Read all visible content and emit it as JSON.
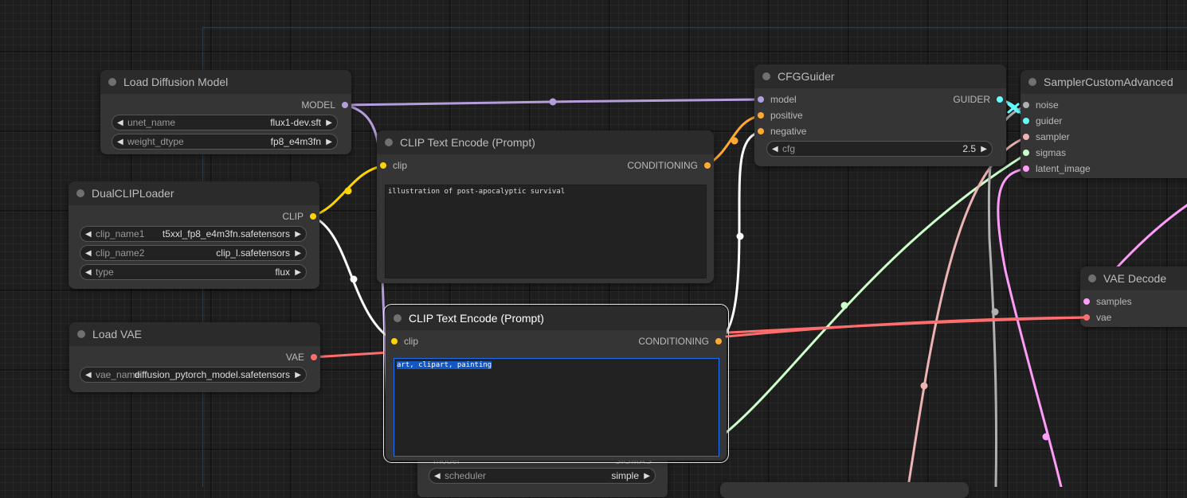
{
  "colors": {
    "model": "#b39ddb",
    "clip": "#ffd500",
    "conditioning": "#ffa931",
    "vae": "#ff6e6e",
    "latent": "#ff9cf9",
    "guider": "#66ffff",
    "noise": "#b0b0b0",
    "sampler": "#ecb4b4",
    "sigmas": "#cdffcd",
    "link_white": "#ffffff"
  },
  "nodes": {
    "load_diffusion_model": {
      "title": "Load Diffusion Model",
      "output_model": "MODEL",
      "unet_name_label": "unet_name",
      "unet_name_value": "flux1-dev.sft",
      "weight_dtype_label": "weight_dtype",
      "weight_dtype_value": "fp8_e4m3fn"
    },
    "dual_clip_loader": {
      "title": "DualCLIPLoader",
      "output_clip": "CLIP",
      "clip_name1_label": "clip_name1",
      "clip_name1_value": "t5xxl_fp8_e4m3fn.safetensors",
      "clip_name2_label": "clip_name2",
      "clip_name2_value": "clip_l.safetensors",
      "type_label": "type",
      "type_value": "flux"
    },
    "load_vae": {
      "title": "Load VAE",
      "output_vae": "VAE",
      "vae_name_label": "vae_name",
      "vae_name_value": "diffusion_pytorch_model.safetensors"
    },
    "clip_text_encode_positive": {
      "title": "CLIP Text Encode (Prompt)",
      "input_clip": "clip",
      "output_conditioning": "CONDITIONING",
      "text": "illustration of post-apocalyptic survival"
    },
    "clip_text_encode_negative": {
      "title": "CLIP Text Encode (Prompt)",
      "input_clip": "clip",
      "output_conditioning": "CONDITIONING",
      "text": "art, clipart, painting"
    },
    "cfg_guider": {
      "title": "CFGGuider",
      "input_model": "model",
      "input_positive": "positive",
      "input_negative": "negative",
      "output_guider": "GUIDER",
      "cfg_label": "cfg",
      "cfg_value": "2.5"
    },
    "sampler_custom_advanced": {
      "title": "SamplerCustomAdvanced",
      "input_noise": "noise",
      "input_guider": "guider",
      "input_sampler": "sampler",
      "input_sigmas": "sigmas",
      "input_latent_image": "latent_image"
    },
    "vae_decode": {
      "title": "VAE Decode",
      "input_samples": "samples",
      "input_vae": "vae"
    },
    "scheduler_node": {
      "partial_left": "model",
      "partial_right": "SIGMAS",
      "scheduler_label": "scheduler",
      "scheduler_value": "simple"
    }
  }
}
